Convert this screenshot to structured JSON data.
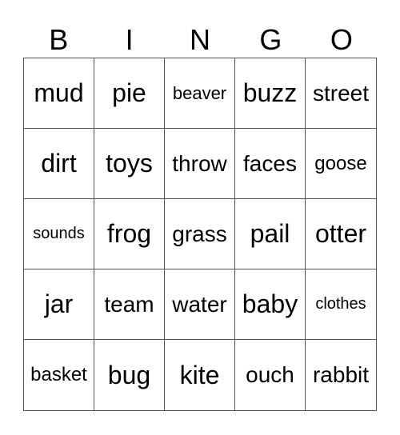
{
  "header": [
    "B",
    "I",
    "N",
    "G",
    "O"
  ],
  "cells": [
    [
      "mud",
      "pie",
      "beaver",
      "buzz",
      "street"
    ],
    [
      "dirt",
      "toys",
      "throw",
      "faces",
      "goose"
    ],
    [
      "sounds",
      "frog",
      "grass",
      "pail",
      "otter"
    ],
    [
      "jar",
      "team",
      "water",
      "baby",
      "clothes"
    ],
    [
      "basket",
      "bug",
      "kite",
      "ouch",
      "rabbit"
    ]
  ]
}
